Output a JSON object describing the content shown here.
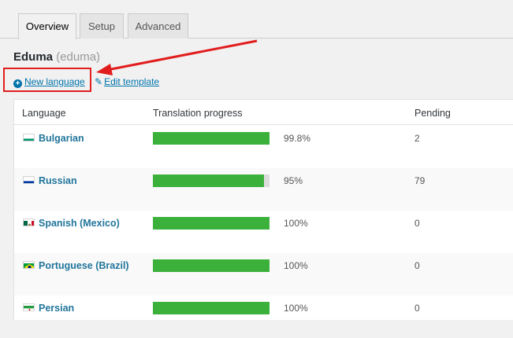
{
  "tabs": [
    {
      "label": "Overview",
      "active": true
    },
    {
      "label": "Setup",
      "active": false
    },
    {
      "label": "Advanced",
      "active": false
    }
  ],
  "project": {
    "name": "Eduma",
    "slug": "(eduma)"
  },
  "links": {
    "new_language": "New language",
    "edit_template": "Edit template"
  },
  "table": {
    "headers": {
      "language": "Language",
      "progress": "Translation progress",
      "pending": "Pending"
    },
    "rows": [
      {
        "language": "Bulgarian",
        "flag": "bulgaria-flag-icon",
        "progress": 99.8,
        "progress_label": "99.8%",
        "pending": "2"
      },
      {
        "language": "Russian",
        "flag": "russia-flag-icon",
        "progress": 95,
        "progress_label": "95%",
        "pending": "79"
      },
      {
        "language": "Spanish (Mexico)",
        "flag": "mexico-flag-icon",
        "progress": 100,
        "progress_label": "100%",
        "pending": "0"
      },
      {
        "language": "Portuguese (Brazil)",
        "flag": "brazil-flag-icon",
        "progress": 100,
        "progress_label": "100%",
        "pending": "0"
      },
      {
        "language": "Persian",
        "flag": "iran-flag-icon",
        "progress": 100,
        "progress_label": "100%",
        "pending": "0"
      }
    ]
  },
  "colors": {
    "link": "#0073aa",
    "progress": "#3bb13b",
    "annotation": "#e21d1d"
  }
}
